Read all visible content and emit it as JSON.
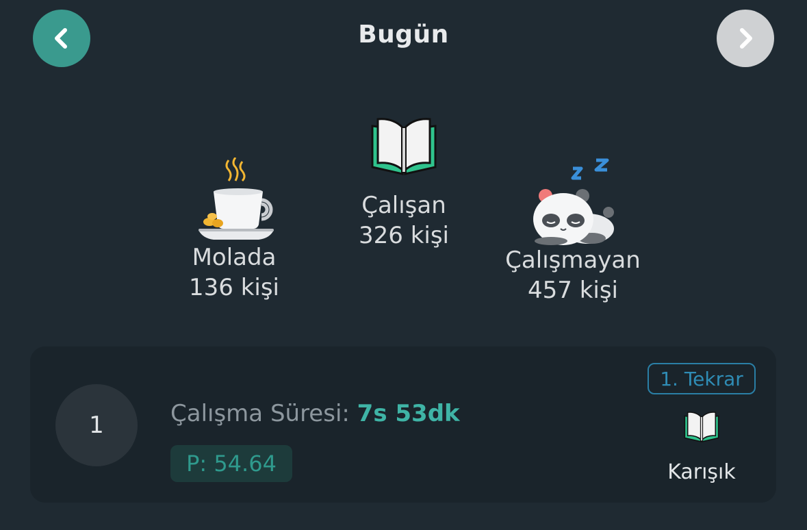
{
  "header": {
    "title": "Bugün",
    "prev_icon": "chevron-left-icon",
    "next_icon": "chevron-right-icon",
    "prev_color": "#3a9a8e",
    "next_color": "#cfd1d3"
  },
  "stats": {
    "break": {
      "label": "Molada",
      "count": "136 kişi",
      "icon": "coffee-cup-icon"
    },
    "working": {
      "label": "Çalışan",
      "count": "326 kişi",
      "icon": "open-book-icon"
    },
    "idle": {
      "label": "Çalışmayan",
      "count": "457 kişi",
      "icon": "sleeping-panda-icon"
    }
  },
  "entry": {
    "rank": "1",
    "duration_label": "Çalışma Süresi:",
    "duration_value": "7s 53dk",
    "points": "P: 54.64",
    "repeat": "1. Tekrar",
    "mode_icon": "open-book-icon",
    "mode": "Karışık"
  },
  "colors": {
    "accent": "#3fb4a6",
    "badge": "#2f8cb5",
    "background": "#1f2a32"
  }
}
